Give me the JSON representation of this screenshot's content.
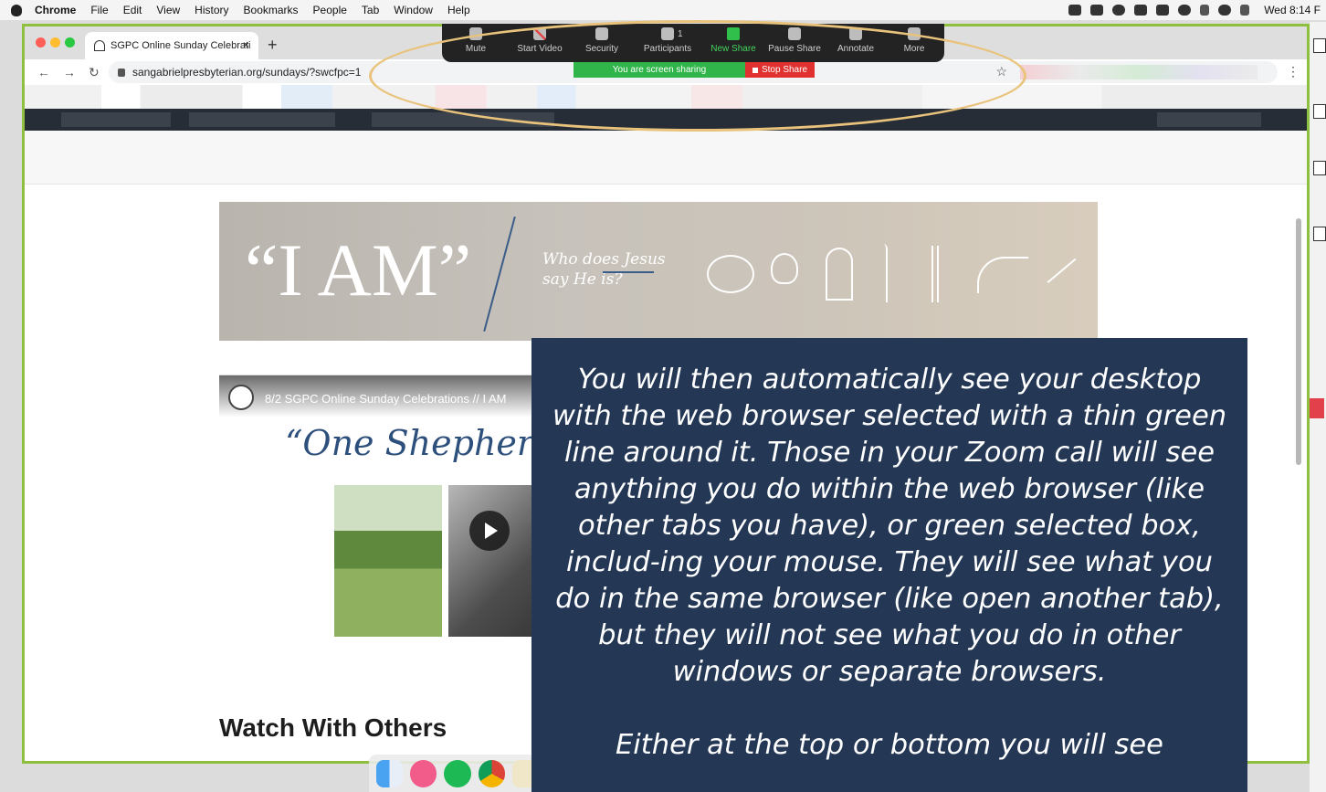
{
  "menubar": {
    "app": "Chrome",
    "items": [
      "File",
      "Edit",
      "View",
      "History",
      "Bookmarks",
      "People",
      "Tab",
      "Window",
      "Help"
    ],
    "clock": "Wed 8:14 F"
  },
  "browser": {
    "tab_title": "SGPC Online Sunday Celebrati",
    "tab_close": "×",
    "new_tab": "+",
    "url": "sangabrielpresbyterian.org/sundays/?swcfpc=1"
  },
  "zoom": {
    "buttons": [
      "Mute",
      "Start Video",
      "Security",
      "Participants",
      "New Share",
      "Pause Share",
      "Annotate",
      "More"
    ],
    "participants_count": "1",
    "sharing_text": "You are screen sharing",
    "stop_share": "Stop Share"
  },
  "page": {
    "banner_title": "“I AM”",
    "banner_subtitle": "Who does Jesus say He is?",
    "video_title": "8/2 SGPC Online Sunday Celebrations // I AM",
    "video_script": "“One Shepherd. &",
    "watch_heading": "Watch With Others"
  },
  "overlay": {
    "paragraph1": "You will then automatically see your desktop with the web browser selected with a thin green line around it. Those in your Zoom call will see anything you do within the web browser (like other tabs you have), or green selected box, includ-ing your mouse. They will see what you do in the same browser (like open another tab), but they will not see what you do in other windows or separate browsers.",
    "paragraph2": "Either at the top or bottom you will see"
  },
  "colors": {
    "share_border": "#8fbf3f",
    "overlay_bg": "#243856",
    "highlight": "#e9c37c",
    "stop_red": "#e0302f",
    "share_green": "#2fb54a"
  }
}
